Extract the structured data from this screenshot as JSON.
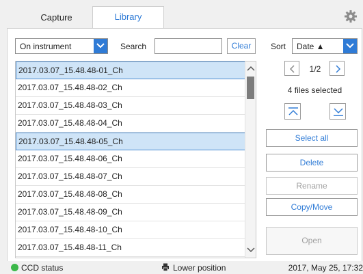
{
  "tabs": [
    {
      "label": "Capture",
      "active": false
    },
    {
      "label": "Library",
      "active": true
    }
  ],
  "toolbar": {
    "source_value": "On instrument",
    "search_label": "Search",
    "search_value": "",
    "clear_label": "Clear",
    "sort_label": "Sort",
    "sort_value": "Date ▲"
  },
  "files": [
    {
      "name": "2017.03.07_15.48.48-01_Ch",
      "selected": true
    },
    {
      "name": "2017.03.07_15.48.48-02_Ch",
      "selected": false
    },
    {
      "name": "2017.03.07_15.48.48-03_Ch",
      "selected": false
    },
    {
      "name": "2017.03.07_15.48.48-04_Ch",
      "selected": false
    },
    {
      "name": "2017.03.07_15.48.48-05_Ch",
      "selected": true
    },
    {
      "name": "2017.03.07_15.48.48-06_Ch",
      "selected": false
    },
    {
      "name": "2017.03.07_15.48.48-07_Ch",
      "selected": false
    },
    {
      "name": "2017.03.07_15.48.48-08_Ch",
      "selected": false
    },
    {
      "name": "2017.03.07_15.48.48-09_Ch",
      "selected": false
    },
    {
      "name": "2017.03.07_15.48.48-10_Ch",
      "selected": false
    },
    {
      "name": "2017.03.07_15.48.48-11_Ch",
      "selected": false
    }
  ],
  "pagination": {
    "text": "1/2"
  },
  "selection_status": "4 files selected",
  "actions": {
    "select_all": "Select all",
    "delete": "Delete",
    "rename": "Rename",
    "copy_move": "Copy/Move",
    "open": "Open"
  },
  "statusbar": {
    "ccd": "CCD status",
    "position": "Lower position",
    "datetime": "2017, May 25, 17:32"
  },
  "colors": {
    "accent": "#2f7bd6",
    "selected_row": "#cfe4f7",
    "status_ok": "#3cb84a"
  },
  "icons": [
    "gear-icon",
    "chevron-down-icon",
    "chevron-left-icon",
    "chevron-right-icon",
    "scroll-to-top-icon",
    "scroll-to-bottom-icon",
    "printer-icon"
  ]
}
